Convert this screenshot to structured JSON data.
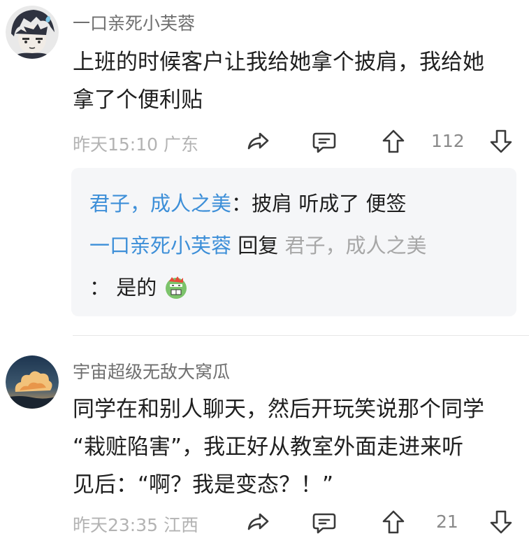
{
  "comments": [
    {
      "username": "一口亲死小芙蓉",
      "lines": [
        "上班的时候客户让我给她拿个披肩，我给她",
        "拿了个便利贴"
      ],
      "time": "昨天15:10",
      "location": "广东",
      "likes": "112",
      "avatar_icon": "anime-boy-avatar"
    },
    {
      "username": "宇宙超级无敌大窝瓜",
      "lines": [
        "同学在和别人聊天，然后开玩笑说那个同学",
        "“栽赃陷害”，我正好从教室外面走进来听",
        "见后：“啊？我是变态？！”"
      ],
      "time": "昨天23:35",
      "location": "江西",
      "likes": "21",
      "avatar_icon": "sunset-cloud-avatar"
    }
  ],
  "replies": {
    "r1": {
      "author": "君子，成人之美",
      "sep": "：",
      "text": "披肩 听成了 便签"
    },
    "r2": {
      "author": "一口亲死小芙蓉",
      "verb": "回复",
      "target": "君子，成人之美",
      "sep": "：",
      "text": "是的",
      "emoji": "green-bitter-face-emoji"
    }
  },
  "colors": {
    "link_blue": "#3d8fd8",
    "meta_grey": "#b3b3b3",
    "reply_bg": "#f5f6f8"
  }
}
